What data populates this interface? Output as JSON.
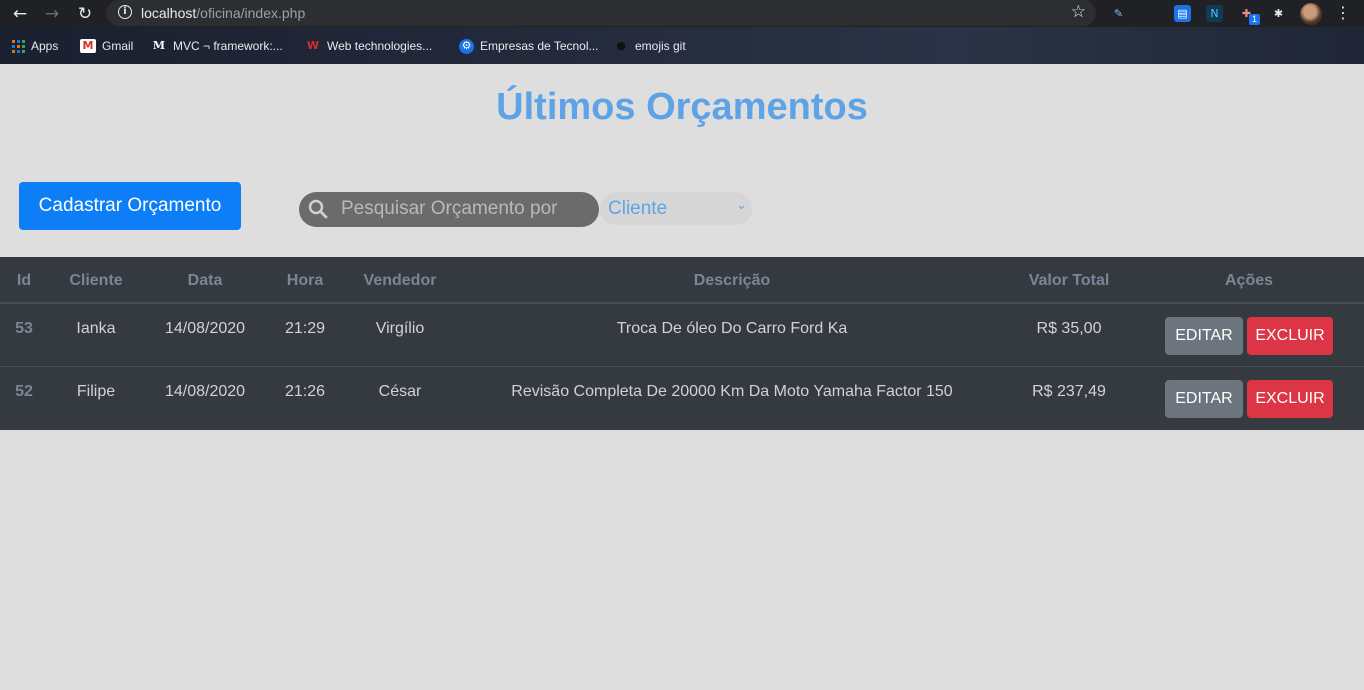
{
  "browser": {
    "url_host": "localhost",
    "url_path": "/oficina/index.php",
    "bookmarks": [
      {
        "label": "Apps",
        "icon": "apps-icon"
      },
      {
        "label": "Gmail",
        "icon": "gmail-icon"
      },
      {
        "label": "MVC ¬ framework:...",
        "icon": "medium-icon"
      },
      {
        "label": "Web technologies...",
        "icon": "w3schools-icon"
      },
      {
        "label": "Empresas de Tecnol...",
        "icon": "gear-icon"
      },
      {
        "label": "emojis git",
        "icon": "github-icon"
      }
    ],
    "extension_badge": "1"
  },
  "page": {
    "title": "Últimos Orçamentos",
    "new_button": "Cadastrar Orçamento",
    "search_placeholder": "Pesquisar Orçamento por",
    "filter_selected": "Cliente"
  },
  "table": {
    "headers": [
      "Id",
      "Cliente",
      "Data",
      "Hora",
      "Vendedor",
      "Descrição",
      "Valor Total",
      "Ações"
    ],
    "rows": [
      {
        "id": "53",
        "cliente": "Ianka",
        "data": "14/08/2020",
        "hora": "21:29",
        "vendedor": "Virgílio",
        "descricao": "Troca De óleo Do Carro Ford Ka",
        "valor": "R$ 35,00",
        "edit": "EDITAR",
        "delete": "EXCLUIR"
      },
      {
        "id": "52",
        "cliente": "Filipe",
        "data": "14/08/2020",
        "hora": "21:26",
        "vendedor": "César",
        "descricao": "Revisão Completa De 20000 Km Da Moto Yamaha Factor 150",
        "valor": "R$ 237,49",
        "edit": "EDITAR",
        "delete": "EXCLUIR"
      }
    ]
  },
  "colors": {
    "title": "#5ea3e6",
    "primary": "#0d7ef5",
    "table_bg": "#343a40",
    "edit": "#6c757d",
    "delete": "#dc3545"
  }
}
